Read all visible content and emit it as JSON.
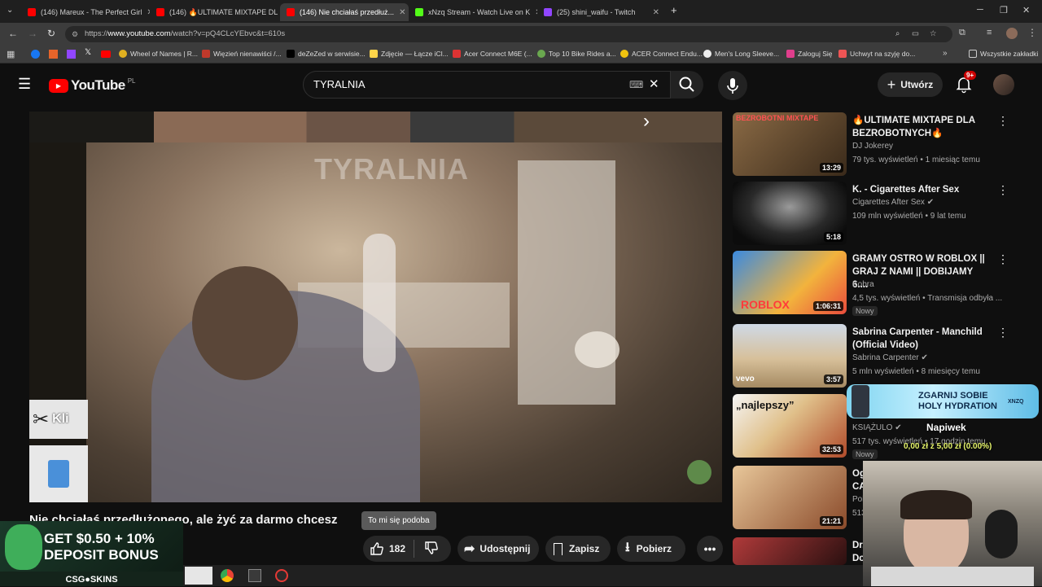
{
  "tabs": [
    {
      "title": "(146) Mareux - The Perfect Girl",
      "color": "#ff0000"
    },
    {
      "title": "(146) 🔥ULTIMATE MIXTAPE DL",
      "color": "#ff0000"
    },
    {
      "title": "(146) Nie chciałaś przedłuż...",
      "color": "#ff0000"
    },
    {
      "title": "xNzq Stream - Watch Live on K",
      "color": "#53fc18"
    },
    {
      "title": "(25) shini_waifu - Twitch",
      "color": "#9146ff"
    }
  ],
  "address": {
    "prefix": "https://",
    "domain": "www.youtube.com",
    "path": "/watch?v=pQ4CLcYEbvc&t=610s"
  },
  "bookmarks": [
    "Wheel of Names | R...",
    "Więzień nienawiści /...",
    "deZeZed w serwisie...",
    "Zdjęcie — Łącze iCl...",
    "Acer Connect M6E (...",
    "Top 10 Bike Rides a...",
    "ACER Connect Endu...",
    "Men's Long Sleeve...",
    "Zaloguj Się",
    "Uchwyt na szyję do..."
  ],
  "bookmarks_all": "Wszystkie zakładki",
  "youtube": {
    "logo": "YouTube",
    "region": "PL",
    "search_value": "TYRALNIA",
    "create_label": "Utwórz",
    "notif_count": "9+"
  },
  "video": {
    "watermark": "TYRALNIA",
    "clip_label": "Kli",
    "title": "Nie chciałaś przedłużonego, ale żyć za darmo chcesz",
    "tooltip": "To mi się podoba",
    "likes": "182",
    "share": "Udostępnij",
    "save": "Zapisz",
    "download": "Pobierz"
  },
  "recommendations": [
    {
      "title": "🔥ULTIMATE MIXTAPE DLA BEZROBOTNYCH🔥",
      "channel": "DJ Jokerey",
      "meta": "79 tys. wyświetleń • 1 miesiąc temu",
      "duration": "13:29",
      "thumb_text": "BEZROBOTNI MIXTAPE",
      "bg": "#6a4a2a"
    },
    {
      "title": "K. - Cigarettes After Sex",
      "channel": "Cigarettes After Sex",
      "meta": "109 mln wyświetleń • 9 lat temu",
      "duration": "5:18",
      "thumb_text": "",
      "bg": "#0c0c0c"
    },
    {
      "title": "GRAMY OSTRO W ROBLOX || GRAJ Z NAMI || DOBIJAMY 6....",
      "channel": "Kobra",
      "meta": "4,5 tys. wyświetleń • Transmisja odbyła ...",
      "duration": "1:06:31",
      "thumb_text": "ROBLOX",
      "badge": "Nowy",
      "bg": "#3a6fd0"
    },
    {
      "title": "Sabrina Carpenter - Manchild (Official Video)",
      "channel": "Sabrina Carpenter",
      "meta": "5 mln wyświetleń • 8 miesięcy temu",
      "duration": "3:57",
      "thumb_text": "vevo",
      "bg": "#b9a37a"
    },
    {
      "title": "",
      "channel": "KSIĄŻULO",
      "meta": "517 tys. wyświetleń • 17 godzin temu",
      "duration": "32:53",
      "thumb_text": "„najlepszy”",
      "badge": "Nowy",
      "bg": "#d8d8d8"
    },
    {
      "title": "Og... CA...",
      "channel": "Pol...",
      "meta": "513...",
      "duration": "21:21",
      "thumb_text": "",
      "bg": "#a06a3a"
    },
    {
      "title": "Dr... Do...",
      "channel": "",
      "meta": "",
      "duration": "",
      "thumb_text": "",
      "bg": "#7a2a2a"
    }
  ],
  "stream_overlay": {
    "promo": "ZGARNIJ SOBIE HOLY HYDRATION",
    "promo_tag": "XNZQ",
    "tip_label": "Napiwek",
    "tip_value": "0,00 zł z 5,00 zł (0.00%)"
  },
  "casino_ad": {
    "line1": "GET $0.50 + 10%",
    "line2": "DEPOSIT BONUS",
    "brand": "CSG●SKINS"
  }
}
